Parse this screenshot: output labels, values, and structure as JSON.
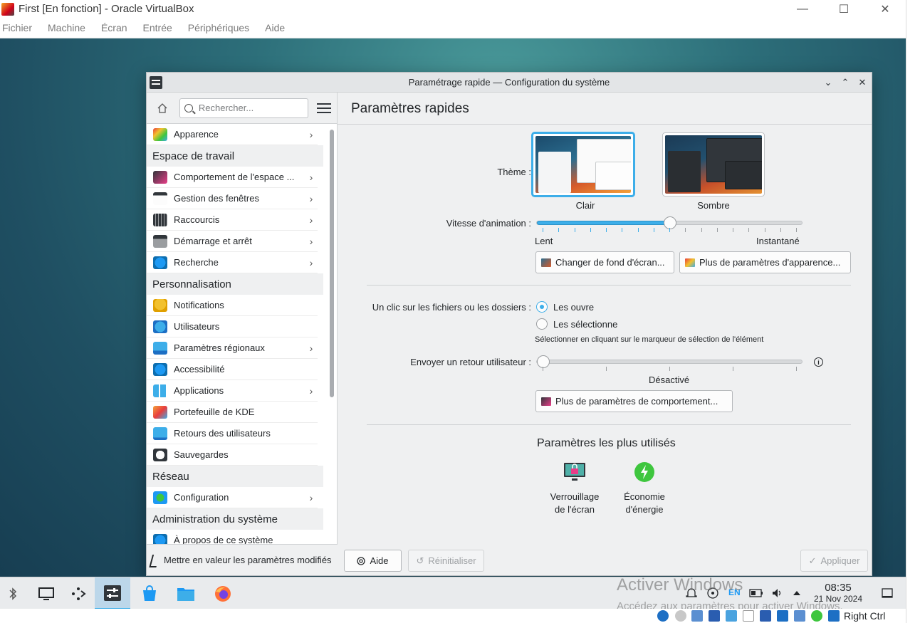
{
  "host": {
    "title": "First [En fonction] - Oracle VirtualBox",
    "controls": [
      "—",
      "☐",
      "✕"
    ],
    "menu": [
      "Fichier",
      "Machine",
      "Écran",
      "Entrée",
      "Périphériques",
      "Aide"
    ],
    "host_key": "Right Ctrl"
  },
  "window": {
    "title": "Paramétrage rapide — Configuration du système",
    "controls": [
      "⌄",
      "⌃",
      "✕"
    ]
  },
  "sidebar": {
    "search_placeholder": "Rechercher...",
    "entries": [
      {
        "kind": "item",
        "label": "Apparence",
        "icon": "appearance-icon",
        "chevron": true
      },
      {
        "kind": "section",
        "label": "Espace de travail"
      },
      {
        "kind": "item",
        "label": "Comportement de l'espace ...",
        "icon": "workspace-behavior-icon",
        "chevron": true
      },
      {
        "kind": "item",
        "label": "Gestion des fenêtres",
        "icon": "window-management-icon",
        "chevron": true
      },
      {
        "kind": "item",
        "label": "Raccourcis",
        "icon": "keyboard-icon",
        "chevron": true
      },
      {
        "kind": "item",
        "label": "Démarrage et arrêt",
        "icon": "startup-icon",
        "chevron": true
      },
      {
        "kind": "item",
        "label": "Recherche",
        "icon": "search-icon",
        "chevron": true
      },
      {
        "kind": "section",
        "label": "Personnalisation"
      },
      {
        "kind": "item",
        "label": "Notifications",
        "icon": "bell-icon",
        "chevron": false
      },
      {
        "kind": "item",
        "label": "Utilisateurs",
        "icon": "users-icon",
        "chevron": false
      },
      {
        "kind": "item",
        "label": "Paramètres régionaux",
        "icon": "regional-icon",
        "chevron": true
      },
      {
        "kind": "item",
        "label": "Accessibilité",
        "icon": "accessibility-icon",
        "chevron": false
      },
      {
        "kind": "item",
        "label": "Applications",
        "icon": "applications-icon",
        "chevron": true
      },
      {
        "kind": "item",
        "label": "Portefeuille de KDE",
        "icon": "wallet-icon",
        "chevron": false
      },
      {
        "kind": "item",
        "label": "Retours des utilisateurs",
        "icon": "feedback-icon",
        "chevron": false
      },
      {
        "kind": "item",
        "label": "Sauvegardes",
        "icon": "backup-icon",
        "chevron": false
      },
      {
        "kind": "section",
        "label": "Réseau"
      },
      {
        "kind": "item",
        "label": "Configuration",
        "icon": "globe-icon",
        "chevron": true
      },
      {
        "kind": "section",
        "label": "Administration du système"
      },
      {
        "kind": "item",
        "label": "À propos de ce système",
        "icon": "info-icon",
        "chevron": false
      }
    ],
    "footer_label": "Mettre en valeur les paramètres modifiés"
  },
  "main": {
    "title": "Paramètres rapides",
    "theme_label": "Thème :",
    "themes": [
      {
        "name": "Clair",
        "selected": true
      },
      {
        "name": "Sombre",
        "selected": false
      }
    ],
    "animation_label": "Vitesse d'animation :",
    "animation_value": 0.5,
    "animation_min": "Lent",
    "animation_max": "Instantané",
    "wallpaper_button": "Changer de fond d'écran...",
    "appearance_button": "Plus de paramètres d'apparence...",
    "click_label": "Un clic sur les fichiers ou les dossiers :",
    "click_open": "Les ouvre",
    "click_select": "Les sélectionne",
    "click_selected": "open",
    "click_hint": "Sélectionner en cliquant sur le marqueur de sélection de l'élément",
    "feedback_label": "Envoyer un retour utilisateur :",
    "feedback_value": 0,
    "feedback_state": "Désactivé",
    "behavior_button": "Plus de paramètres de comportement...",
    "most_used_title": "Paramètres les plus utilisés",
    "most_used": [
      {
        "line1": "Verrouillage",
        "line2": "de l'écran"
      },
      {
        "line1": "Économie",
        "line2": "d'énergie"
      }
    ],
    "help_button": "Aide",
    "reset_button": "Réinitialiser",
    "apply_button": "Appliquer"
  },
  "taskbar": {
    "time": "08:35",
    "date": "21 Nov 2024",
    "keyboard_layout": "EN",
    "watermark_title": "Activer Windows",
    "watermark_sub": "Accédez aux paramètres pour activer Windows."
  },
  "colors": {
    "accent": "#3daee9",
    "window_bg": "#eff0f1",
    "desktop": "#2d6f7a"
  }
}
